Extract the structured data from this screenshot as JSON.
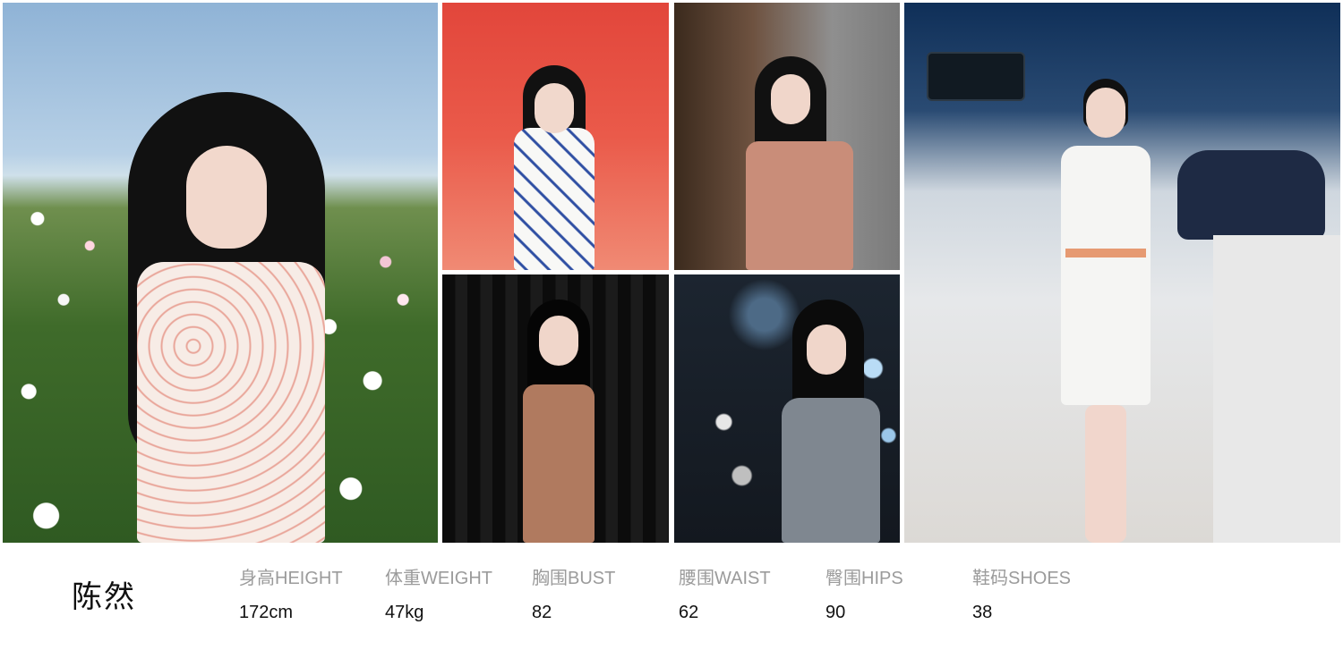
{
  "profile": {
    "name": "陈然",
    "stats": [
      {
        "label": "身高HEIGHT",
        "value": "172cm"
      },
      {
        "label": "体重WEIGHT",
        "value": "47kg"
      },
      {
        "label": "胸围BUST",
        "value": "82"
      },
      {
        "label": "腰围WAIST",
        "value": "62"
      },
      {
        "label": "臀围HIPS",
        "value": "90"
      },
      {
        "label": "鞋码SHOES",
        "value": "38"
      }
    ]
  },
  "theme": {
    "background": "#ffffff",
    "label_color": "#9b9b9b",
    "value_color": "#111111"
  }
}
